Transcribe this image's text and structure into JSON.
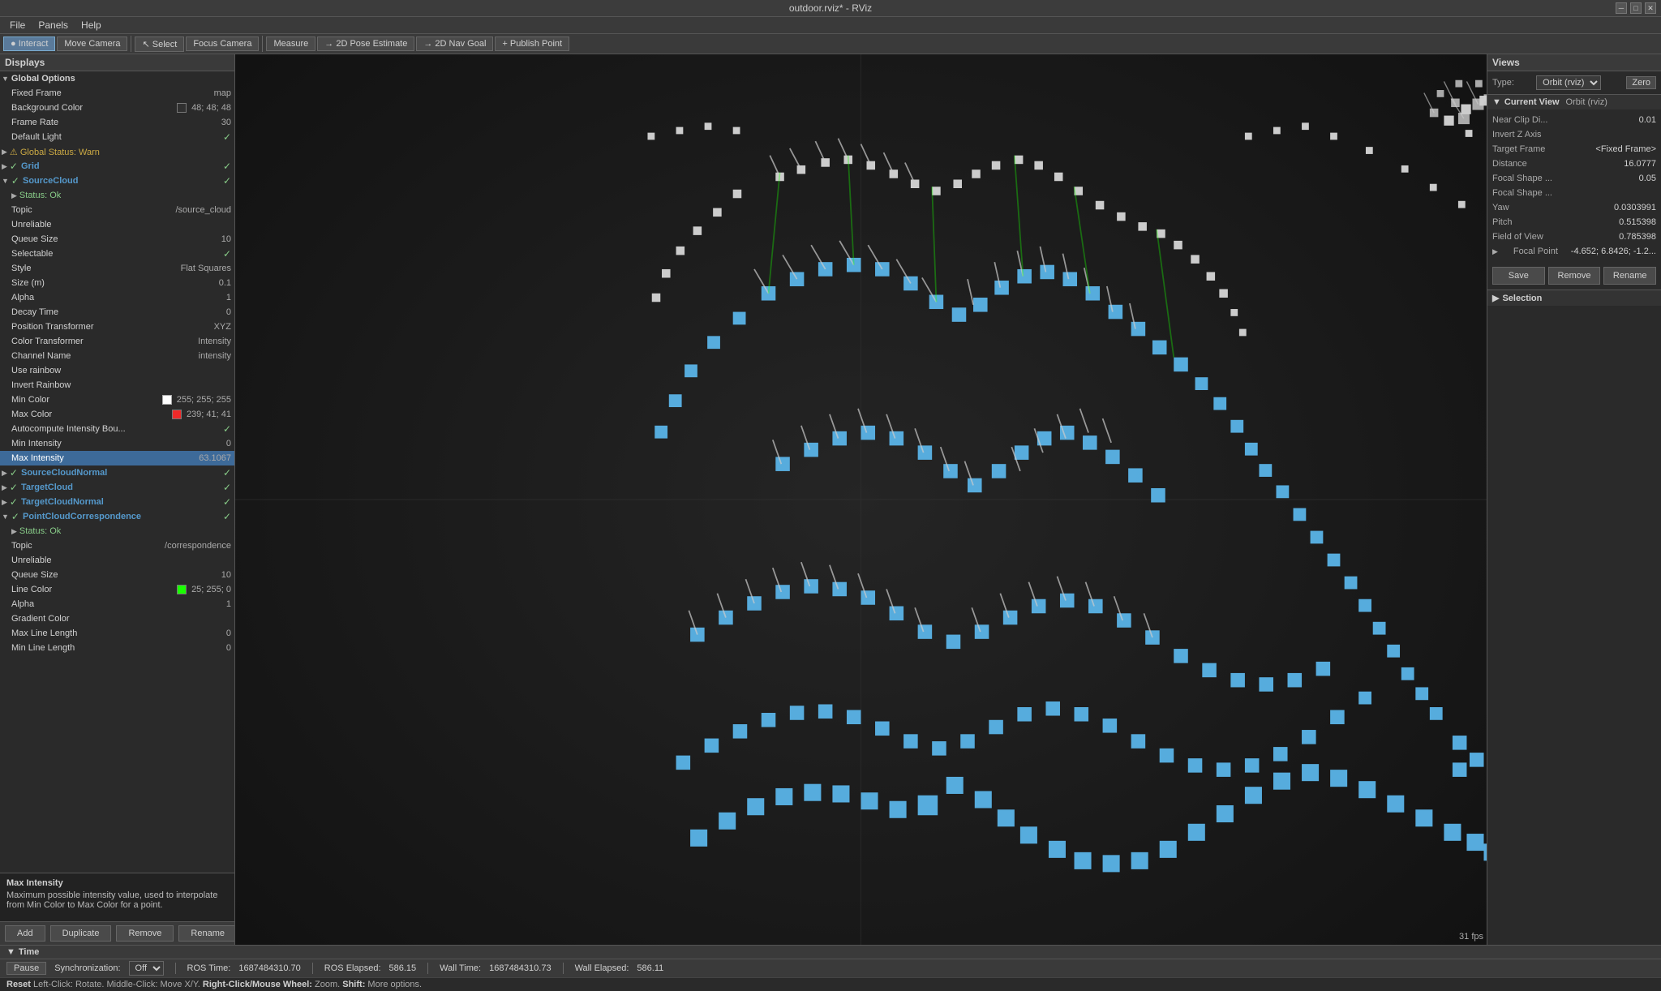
{
  "window": {
    "title": "outdoor.rviz* - RViz"
  },
  "menubar": {
    "items": [
      "File",
      "Panels",
      "Help"
    ]
  },
  "toolbar": {
    "buttons": [
      {
        "label": "Interact",
        "icon": "●",
        "active": true
      },
      {
        "label": "Move Camera",
        "active": false
      },
      {
        "label": "Select",
        "icon": "↖",
        "active": false
      },
      {
        "label": "Focus Camera",
        "active": false
      },
      {
        "label": "Measure",
        "active": false
      },
      {
        "label": "2D Pose Estimate",
        "icon": "→",
        "active": false
      },
      {
        "label": "2D Nav Goal",
        "icon": "→",
        "active": false
      },
      {
        "label": "Publish Point",
        "icon": "+",
        "active": false
      }
    ]
  },
  "displays": {
    "header": "Displays",
    "global_options": {
      "title": "Global Options",
      "fixed_frame": {
        "label": "Fixed Frame",
        "value": "map"
      },
      "background_color": {
        "label": "Background Color",
        "value": "48; 48; 48",
        "hex": "#303030"
      },
      "frame_rate": {
        "label": "Frame Rate",
        "value": "30"
      },
      "default_light": {
        "label": "Default Light",
        "value": "✓"
      }
    },
    "global_status": {
      "label": "Global Status: Warn",
      "status": "warn"
    },
    "grid": {
      "label": "Grid",
      "checked": true
    },
    "source_cloud": {
      "label": "SourceCloud",
      "checked": true,
      "status": "Status: Ok",
      "topic": {
        "label": "Topic",
        "value": "/source_cloud"
      },
      "unreliable": {
        "label": "Unreliable",
        "value": ""
      },
      "queue_size": {
        "label": "Queue Size",
        "value": "10"
      },
      "selectable": {
        "label": "Selectable",
        "value": "✓"
      },
      "style": {
        "label": "Style",
        "value": "Flat Squares"
      },
      "size": {
        "label": "Size (m)",
        "value": "0.1"
      },
      "alpha": {
        "label": "Alpha",
        "value": "1"
      },
      "decay_time": {
        "label": "Decay Time",
        "value": "0"
      },
      "position_transformer": {
        "label": "Position Transformer",
        "value": "XYZ"
      },
      "color_transformer": {
        "label": "Color Transformer",
        "value": "Intensity"
      },
      "channel_name": {
        "label": "Channel Name",
        "value": "intensity"
      },
      "use_rainbow": {
        "label": "Use rainbow",
        "value": ""
      },
      "invert_rainbow": {
        "label": "Invert Rainbow",
        "value": ""
      },
      "min_color": {
        "label": "Min Color",
        "value": "255; 255; 255",
        "hex": "#ffffff"
      },
      "max_color": {
        "label": "Max Color",
        "value": "239; 41; 41",
        "hex": "#ef2929"
      },
      "autocompute": {
        "label": "Autocompute Intensity Bou...",
        "value": "✓"
      },
      "min_intensity": {
        "label": "Min Intensity",
        "value": "0"
      },
      "max_intensity": {
        "label": "Max Intensity",
        "value": "63.1067",
        "highlighted": true
      }
    },
    "source_cloud_normal": {
      "label": "SourceCloudNormal",
      "checked": true
    },
    "target_cloud": {
      "label": "TargetCloud",
      "checked": true
    },
    "target_cloud_normal": {
      "label": "TargetCloudNormal",
      "checked": true
    },
    "point_cloud_correspondence": {
      "label": "PointCloudCorrespondence",
      "checked": true,
      "status": "Status: Ok",
      "topic": {
        "label": "Topic",
        "value": "/correspondence"
      },
      "unreliable": {
        "label": "Unreliable",
        "value": ""
      },
      "queue_size": {
        "label": "Queue Size",
        "value": "10"
      },
      "line_color": {
        "label": "Line Color",
        "value": "25; 255; 0",
        "hex": "#19ff00"
      },
      "alpha": {
        "label": "Alpha",
        "value": "1"
      },
      "gradient_color": {
        "label": "Gradient Color",
        "value": ""
      },
      "max_line_length": {
        "label": "Max Line Length",
        "value": "0"
      },
      "min_line_length": {
        "label": "Min Line Length",
        "value": "0"
      }
    }
  },
  "tooltip": {
    "title": "Max Intensity",
    "text": "Maximum possible intensity value, used to interpolate\nfrom Min Color to Max Color for a point."
  },
  "displays_buttons": [
    "Add",
    "Duplicate",
    "Remove",
    "Rename"
  ],
  "views_panel": {
    "header": "Views",
    "type_label": "Type:",
    "type_value": "Orbit (rviz)",
    "zero_button": "Zero",
    "current_view": {
      "label": "Current View",
      "type": "Orbit (rviz)",
      "near_clip_di": {
        "label": "Near Clip Di...",
        "value": "0.01"
      },
      "invert_z_axis": {
        "label": "Invert Z Axis",
        "value": ""
      },
      "target_frame": {
        "label": "Target Frame",
        "value": "<Fixed Frame>"
      },
      "distance": {
        "label": "Distance",
        "value": "16.0777"
      },
      "focal_shape": {
        "label": "Focal Shape ...",
        "value": "0.05"
      },
      "focal_shape2": {
        "label": "Focal Shape ...",
        "value": ""
      },
      "yaw": {
        "label": "Yaw",
        "value": "0.0303991"
      },
      "pitch": {
        "label": "Pitch",
        "value": "0.515398"
      },
      "fov": {
        "label": "Field of View",
        "value": "0.785398"
      },
      "focal_point": {
        "label": "Focal Point",
        "value": "-4.652; 6.8426; -1.2..."
      }
    },
    "buttons": [
      "Save",
      "Remove",
      "Rename"
    ],
    "selection_header": "Selection"
  },
  "time_section": {
    "header": "Time",
    "pause_btn": "Pause",
    "sync_label": "Synchronization:",
    "sync_value": "Off",
    "ros_time_label": "ROS Time:",
    "ros_time_value": "1687484310.70",
    "ros_elapsed_label": "ROS Elapsed:",
    "ros_elapsed_value": "586.15",
    "wall_time_label": "Wall Time:",
    "wall_time_value": "1687484310.73",
    "wall_elapsed_label": "Wall Elapsed:",
    "wall_elapsed_value": "586.11"
  },
  "status_hint": "Reset  Left-Click: Rotate.  Middle-Click: Move X/Y.  Right-Click/Mouse Wheel: Zoom.  Shift: More options.",
  "fps": "31 fps",
  "colors": {
    "accent_blue": "#5599cc",
    "bg_dark": "#1a1a1a",
    "bg_medium": "#2a2a2a",
    "bg_light": "#3a3a3a",
    "selected_row": "#3d6a99",
    "highlight": "#3d6a99"
  }
}
